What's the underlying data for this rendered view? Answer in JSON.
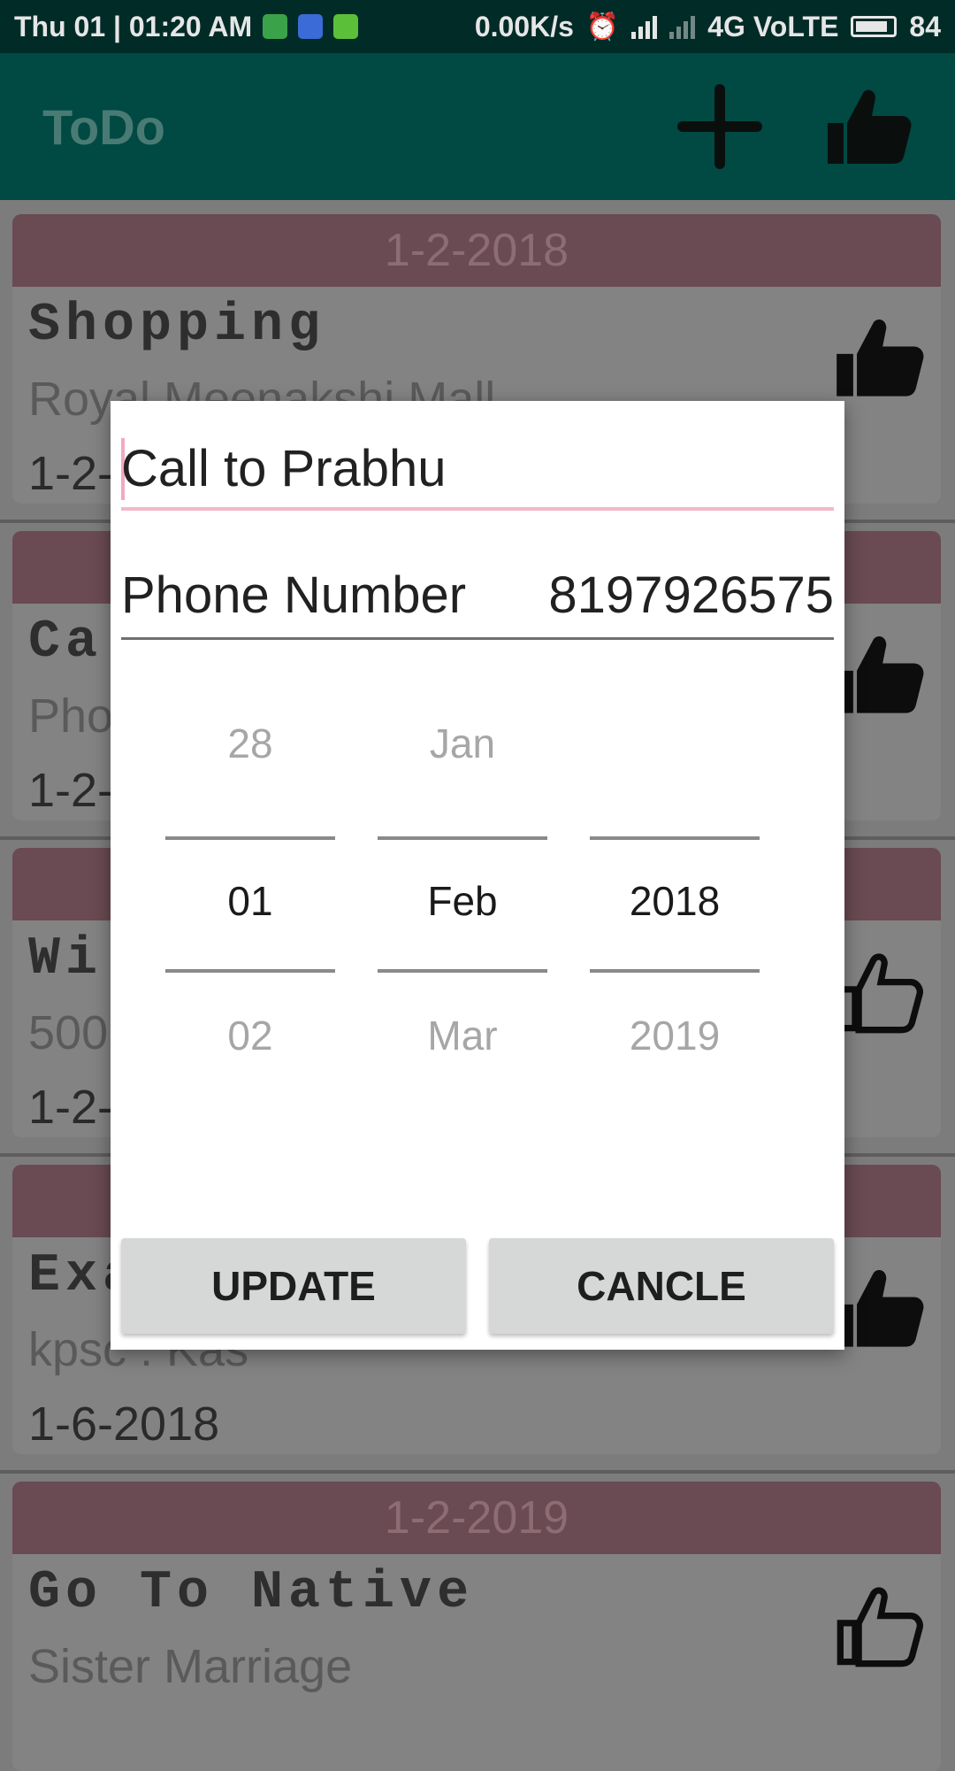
{
  "status_bar": {
    "time": "Thu 01 | 01:20 AM",
    "speed": "0.00K/s",
    "network": "4G VoLTE",
    "battery": "84"
  },
  "app_bar": {
    "title": "ToDo",
    "add_icon": "plus-icon",
    "like_icon": "thumbs-up-icon"
  },
  "list": {
    "cards": [
      {
        "header": "1-2-2018",
        "title": "Shopping",
        "subtitle": "Royal Meenakshi Mall",
        "date": "1-2-"
      },
      {
        "header": "",
        "title": "Ca",
        "subtitle": "Pho",
        "date": "1-2-"
      },
      {
        "header": "",
        "title": "Wi",
        "subtitle": "500",
        "date": "1-2-"
      },
      {
        "header": "",
        "title": "Exa",
        "subtitle": "kpsc : Kas",
        "date": "1-6-2018"
      },
      {
        "header": "1-2-2019",
        "title": "Go To Native",
        "subtitle": "Sister Marriage",
        "date": ""
      }
    ]
  },
  "dialog": {
    "title_value": "Call to Prabhu",
    "phone_label": "Phone Number",
    "phone_value": "8197926575",
    "picker": {
      "day": {
        "prev": "28",
        "selected": "01",
        "next": "02"
      },
      "month": {
        "prev": "Jan",
        "selected": "Feb",
        "next": "Mar"
      },
      "year": {
        "prev": "",
        "selected": "2018",
        "next": "2019"
      }
    },
    "update_label": "UPDATE",
    "cancel_label": "CANCLE"
  },
  "colors": {
    "app_bar": "#004a43",
    "status_bar": "#002b27",
    "accent_pink": "#f2b9c9",
    "card_header": "#6a4a53"
  }
}
